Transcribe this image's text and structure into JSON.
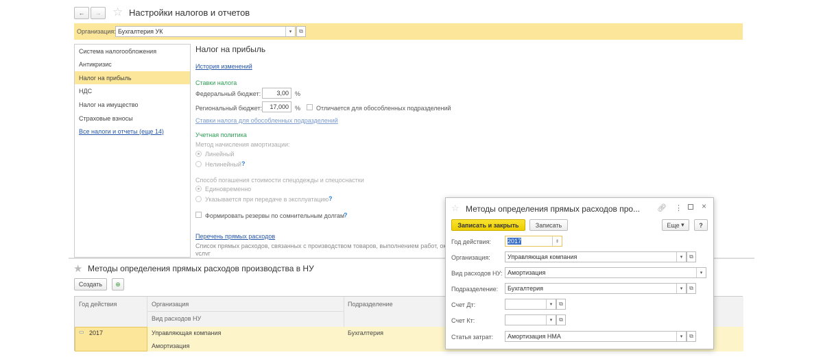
{
  "window": {
    "title": "Настройки налогов и отчетов",
    "back": "←",
    "forward": "→"
  },
  "org_bar": {
    "label": "Организация:",
    "value": "Бухгалтерия УК"
  },
  "sidebar": {
    "items": [
      {
        "label": "Система налогообложения"
      },
      {
        "label": "Антикризис"
      },
      {
        "label": "Налог на прибыль",
        "selected": true
      },
      {
        "label": "НДС"
      },
      {
        "label": "Налог на имущество"
      },
      {
        "label": "Страховые взносы"
      }
    ],
    "all_link": "Все налоги и отчеты (еще 14)"
  },
  "main": {
    "title": "Налог на прибыль",
    "history_link": "История изменений",
    "rates_header": "Ставки налога",
    "federal_label": "Федеральный бюджет:",
    "federal_value": "3,00",
    "regional_label": "Региональный бюджет:",
    "regional_value": "17,000",
    "percent": "%",
    "differs_label": "Отличается для обособленных подразделений",
    "differs_checked": false,
    "branch_rates_link": "Ставки налога для обособленных подразделений",
    "policy_header": "Учетная политика",
    "amort_label": "Метод начисления амортизации:",
    "amort_options": [
      "Линейный",
      "Нелинейный"
    ],
    "amort_selected": "Линейный",
    "workwear_label": "Способ погашения стоимости спецодежды и спецоснастки",
    "workwear_options": [
      "Единовременно",
      "Указывается при передаче в эксплуатацию"
    ],
    "workwear_selected": "Единовременно",
    "reserves_label": "Формировать резервы по сомнительным долгам",
    "reserves_checked": false,
    "help": "?",
    "direct_link": "Перечень прямых расходов",
    "direct_desc": "Список прямых расходов, связанных с производством товаров, выполнением работ, ока",
    "direct_desc2": "услуг"
  },
  "list": {
    "title": "Методы определения прямых расходов производства в НУ",
    "create": "Создать",
    "columns": {
      "year": "Год действия",
      "org": "Организация",
      "kind": "Вид расходов НУ",
      "dept": "Подразделение"
    },
    "rows": [
      {
        "year": "2017",
        "org": "Управляющая компания",
        "kind": "Амортизация",
        "dept": "Бухгалтерия"
      }
    ]
  },
  "dialog": {
    "title": "Методы определения прямых расходов про...",
    "save_close": "Записать и закрыть",
    "save": "Записать",
    "more": "Еще",
    "help": "?",
    "fields": {
      "year_label": "Год действия:",
      "year": "2017",
      "org_label": "Организация:",
      "org": "Управляющая компания",
      "kind_label": "Вид расходов НУ:",
      "kind": "Амортизация",
      "dept_label": "Подразделение:",
      "dept": "Бухгалтерия",
      "dt_label": "Счет Дт:",
      "dt": "",
      "kt_label": "Счет Кт:",
      "kt": "",
      "cost_label": "Статья затрат:",
      "cost": "Амортизация НМА"
    }
  },
  "colors": {
    "accent_yellow": "#fbe69a",
    "selected_row": "#fdf5c9",
    "primary_button": "#f5d90c",
    "link": "#2255aa",
    "section_green": "#2e9e55"
  }
}
